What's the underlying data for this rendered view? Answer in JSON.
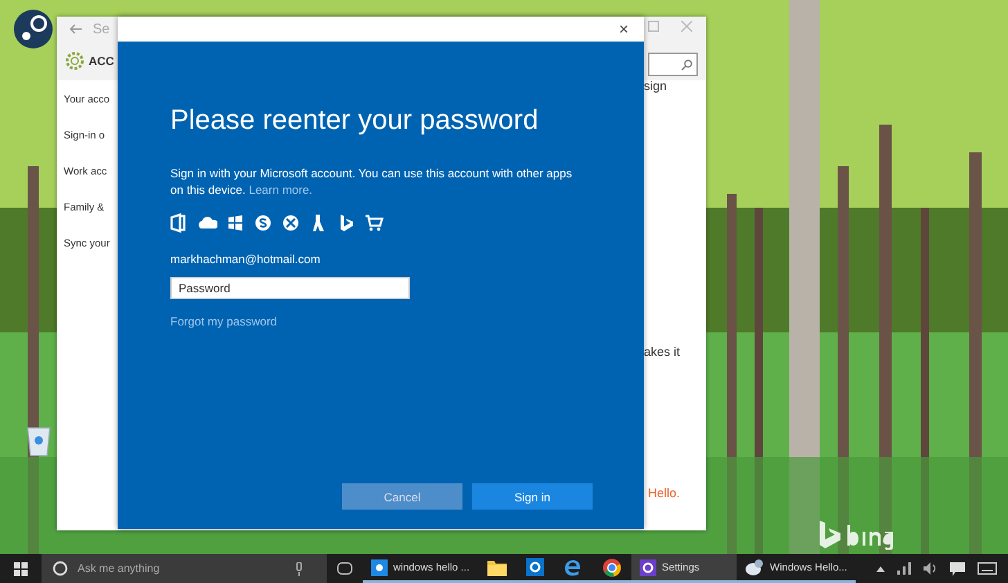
{
  "settings_window": {
    "title": "Se",
    "header": "ACC",
    "nav_items": [
      {
        "label": "Your acco"
      },
      {
        "label": "Sign-in o"
      },
      {
        "label": "Work acc"
      },
      {
        "label": "Family &"
      },
      {
        "label": "Sync your"
      }
    ],
    "content_fragments": [
      "sign",
      "akes it"
    ],
    "link_fragment": "Hello."
  },
  "dialog": {
    "close": "×",
    "title": "Please reenter your password",
    "body": "Sign in with your Microsoft account. You can use this account with other apps on this device.",
    "learn_more": "Learn more.",
    "email": "markhachman@hotmail.com",
    "password": {
      "placeholder": "Password"
    },
    "forgot": "Forgot my password",
    "buttons": [
      {
        "label": "Cancel",
        "kind": "secondary"
      },
      {
        "label": "Sign in",
        "kind": "primary"
      }
    ]
  },
  "taskbar": {
    "search": {
      "placeholder": "Ask me anything"
    },
    "items": [
      {
        "kind": "window",
        "label": "windows hello ...",
        "selected": false
      },
      {
        "kind": "pinned"
      },
      {
        "kind": "pinned"
      },
      {
        "kind": "pinned"
      },
      {
        "kind": "pinned"
      },
      {
        "kind": "window",
        "label": "Settings",
        "selected": true
      },
      {
        "kind": "window",
        "label": "Windows Hello...",
        "selected": false
      }
    ]
  }
}
